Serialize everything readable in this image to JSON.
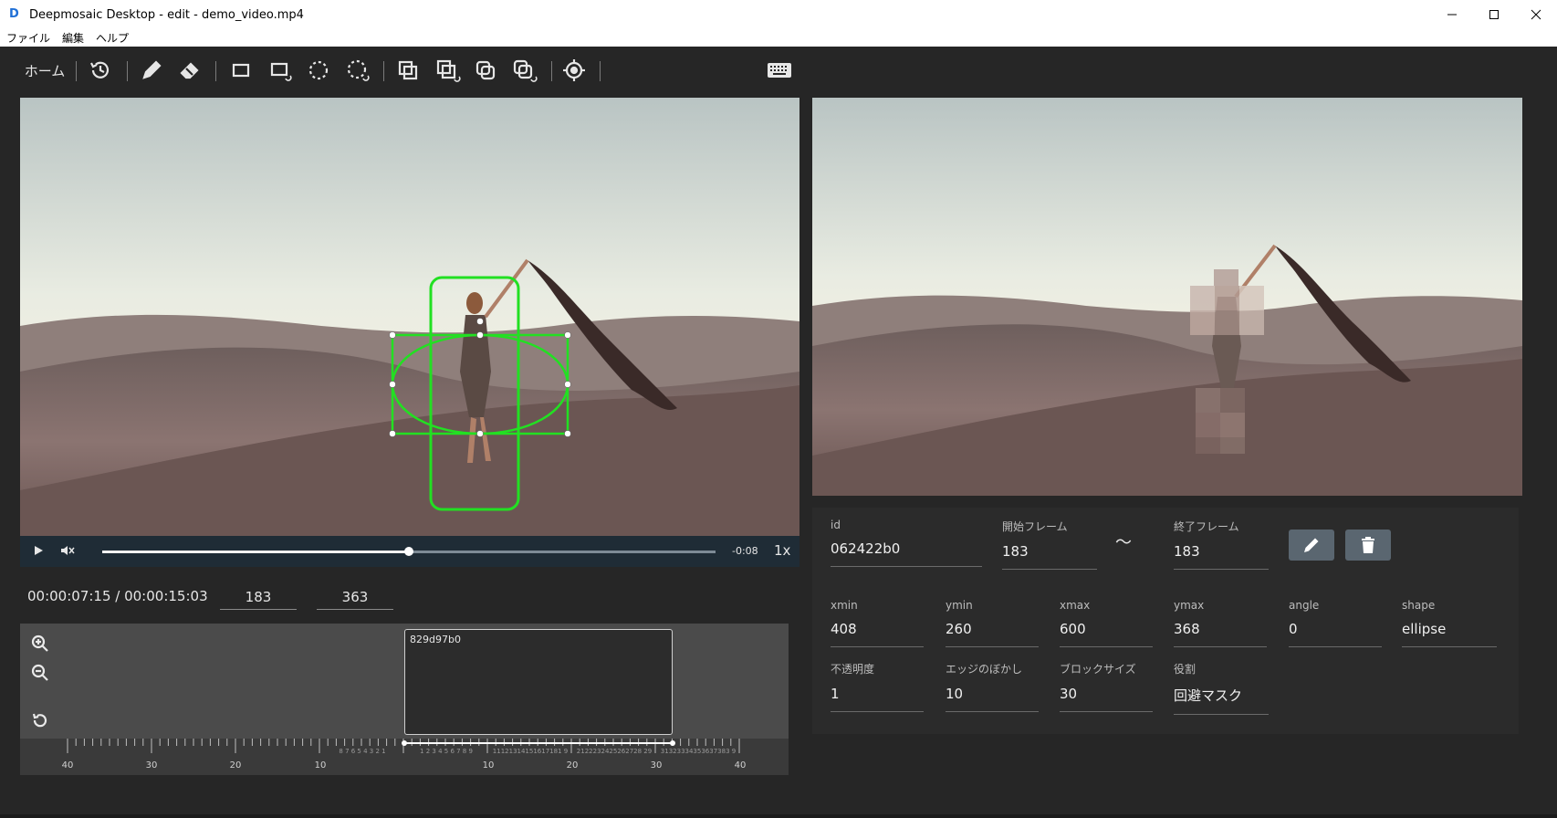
{
  "window": {
    "title": "Deepmosaic Desktop - edit - demo_video.mp4",
    "app_icon": "D",
    "controls": [
      "minimize-icon",
      "maximize-icon",
      "close-icon"
    ]
  },
  "menu": {
    "file": "ファイル",
    "edit": "編集",
    "help": "ヘルプ"
  },
  "toolbar": {
    "home_label": "ホーム",
    "icons": [
      "history-icon",
      "pencil-icon",
      "eraser-icon",
      "rectangle-icon",
      "rectangle-track-icon",
      "ellipse-icon",
      "ellipse-track-icon",
      "copy-icon",
      "copy-track-icon",
      "copy-alt-icon",
      "copy-alt-track-icon",
      "target-icon",
      "keyboard-icon"
    ]
  },
  "player": {
    "remaining": "-0:08",
    "speed": "1x",
    "progress": 0.5
  },
  "timecode": "00:00:07:15 / 00:00:15:03",
  "frames": {
    "start": "183",
    "end": "363"
  },
  "timeline": {
    "clip_label": "829d97b0",
    "ruler_labels": [
      "40",
      "30",
      "20",
      "10",
      "10",
      "20",
      "30",
      "40"
    ],
    "left_small_labels": "8 7 6 5 4 3 2 1",
    "right_small_labels": "1 2 3 4 5 6 7 8 9",
    "right_small_labels2": "11121314151617181 9",
    "right_small_labels3": "2122232425262728 29",
    "right_small_labels4": "31323334353637383 9"
  },
  "properties": {
    "id": {
      "label": "id",
      "value": "062422b0"
    },
    "start_frame": {
      "label": "開始フレーム",
      "value": "183"
    },
    "tilde": "〜",
    "end_frame": {
      "label": "終了フレーム",
      "value": "183"
    },
    "xmin": {
      "label": "xmin",
      "value": "408"
    },
    "ymin": {
      "label": "ymin",
      "value": "260"
    },
    "xmax": {
      "label": "xmax",
      "value": "600"
    },
    "ymax": {
      "label": "ymax",
      "value": "368"
    },
    "angle": {
      "label": "angle",
      "value": "0"
    },
    "shape": {
      "label": "shape",
      "value": "ellipse"
    },
    "opacity": {
      "label": "不透明度",
      "value": "1"
    },
    "edge_blur": {
      "label": "エッジのぼかし",
      "value": "10"
    },
    "block_size": {
      "label": "ブロックサイズ",
      "value": "30"
    },
    "role": {
      "label": "役割",
      "value": "回避マスク"
    }
  },
  "colors": {
    "selection": "#22e022",
    "panel_bg": "#2b2b2b",
    "app_bg": "#262626",
    "button_bg": "#5a6670"
  }
}
